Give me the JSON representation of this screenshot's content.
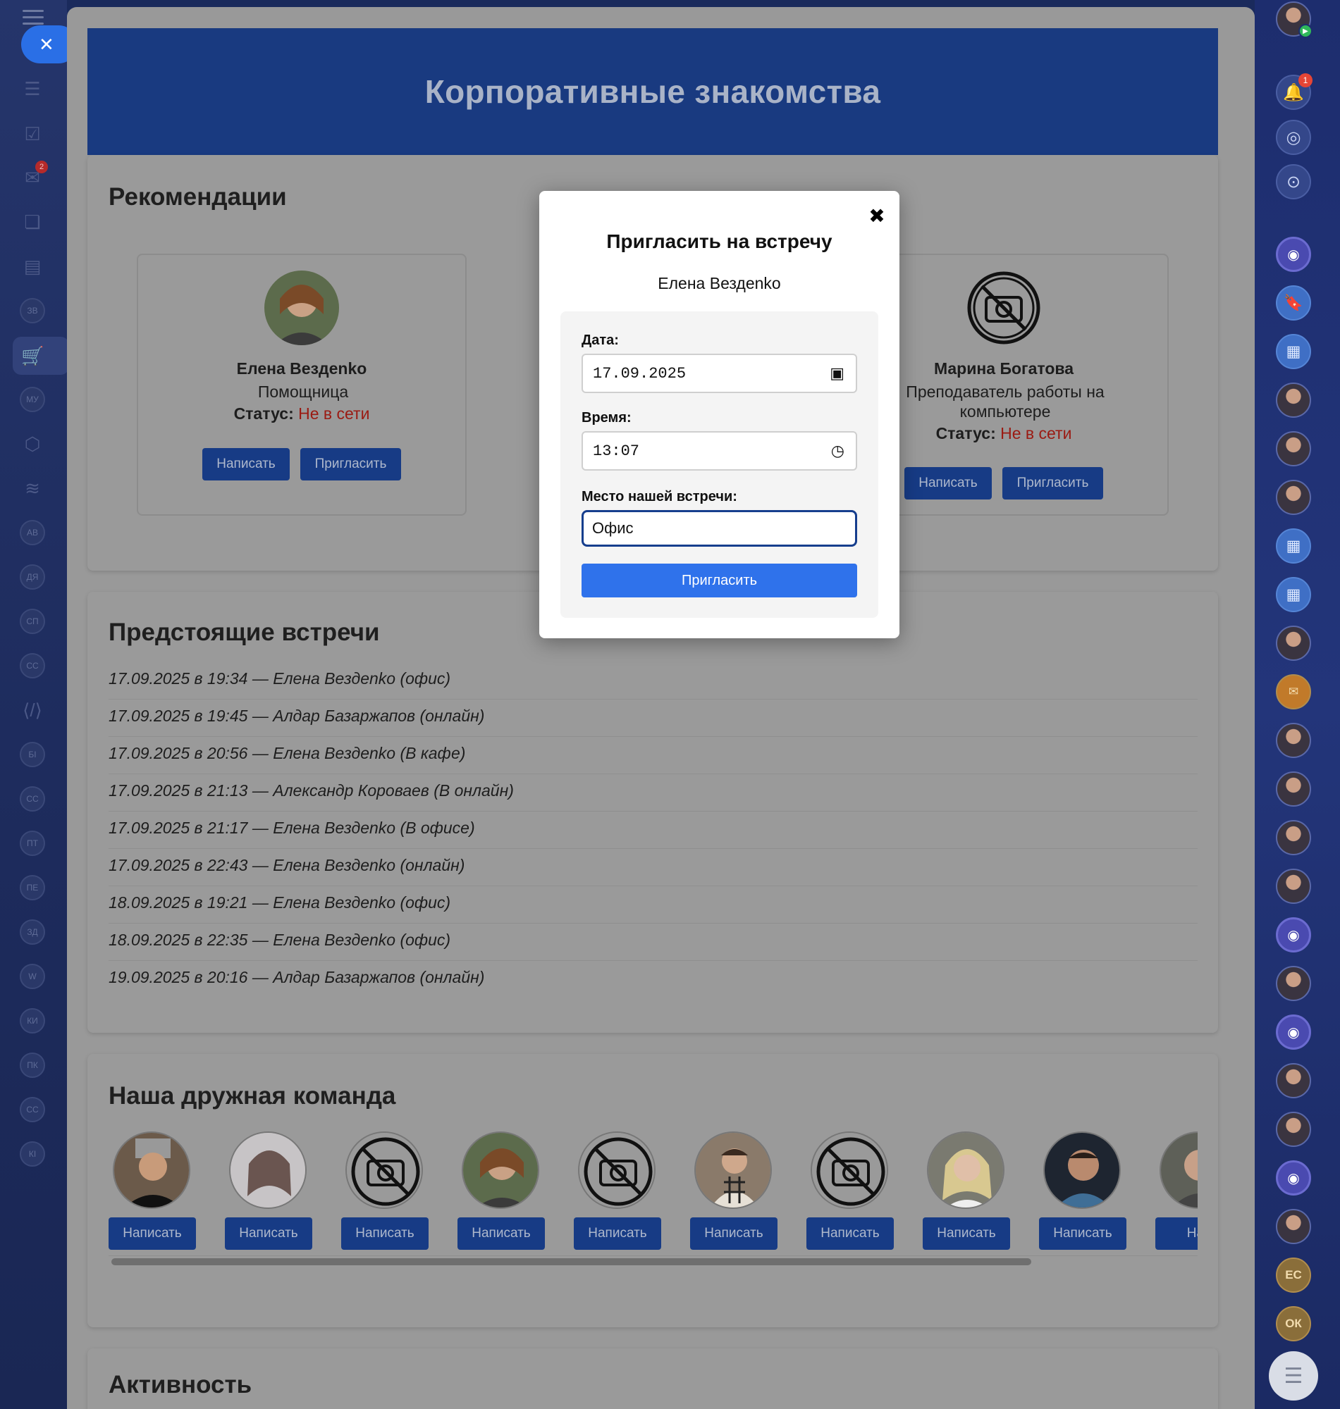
{
  "hero": {
    "title": "Корпоративные знакомства"
  },
  "recommendations": {
    "title": "Рекомендации",
    "status_label": "Статус:",
    "cards": [
      {
        "name": "Елена Вездenko",
        "role": "Помощница",
        "status": "Не в сети",
        "write": "Написать",
        "invite": "Пригласить"
      },
      {
        "name": "Марина Богатова",
        "role": "Преподаватель работы на компьютере",
        "status": "Не в сети",
        "write": "Написать",
        "invite": "Пригласить"
      }
    ]
  },
  "modal": {
    "title": "Пригласить на встречу",
    "person": "Елена Вездenko",
    "date_label": "Дата:",
    "date_value": "17.09.2025",
    "time_label": "Время:",
    "time_value": "13:07",
    "place_label": "Место нашей встречи:",
    "place_value": "Офис",
    "submit": "Пригласить",
    "close": "✖"
  },
  "meetings": {
    "title": "Предстоящие встречи",
    "items": [
      "17.09.2025 в 19:34 — Елена Вездenko (офис)",
      "17.09.2025 в 19:45 — Алдар Базаржапов (онлайн)",
      "17.09.2025 в 20:56 — Елена Вездenko (В кафе)",
      "17.09.2025 в 21:13 — Александр Короваев (В онлайн)",
      "17.09.2025 в 21:17 — Елена Вездenko (В офисе)",
      "17.09.2025 в 22:43 — Елена Вездenko (онлайн)",
      "18.09.2025 в 19:21 — Елена Вездenko (офис)",
      "18.09.2025 в 22:35 — Елена Вездenko (офис)",
      "19.09.2025 в 20:16 — Алдар Базаржапов (онлайн)"
    ]
  },
  "team": {
    "title": "Наша дружная команда",
    "write": "Написать",
    "last_button_partial": "Нап"
  },
  "activity": {
    "title": "Активность"
  },
  "left_sidebar": {
    "badge_count": "2",
    "items": [
      "ЗВ",
      "МУ",
      "АВ",
      "ДЯ",
      "СП",
      "СС",
      "БІ",
      "СС",
      "ПТ",
      "ПЕ",
      "ЗД",
      "W",
      "КИ",
      "ПК",
      "СС",
      "КІ"
    ]
  },
  "right_rail": {
    "notification_count": "1",
    "initials": [
      "ЕС",
      "ОК"
    ]
  },
  "colors": {
    "hero_bg": "#193a80",
    "button_dark": "#173b85",
    "submit": "#2f72eb",
    "offline": "#9b1a12"
  }
}
